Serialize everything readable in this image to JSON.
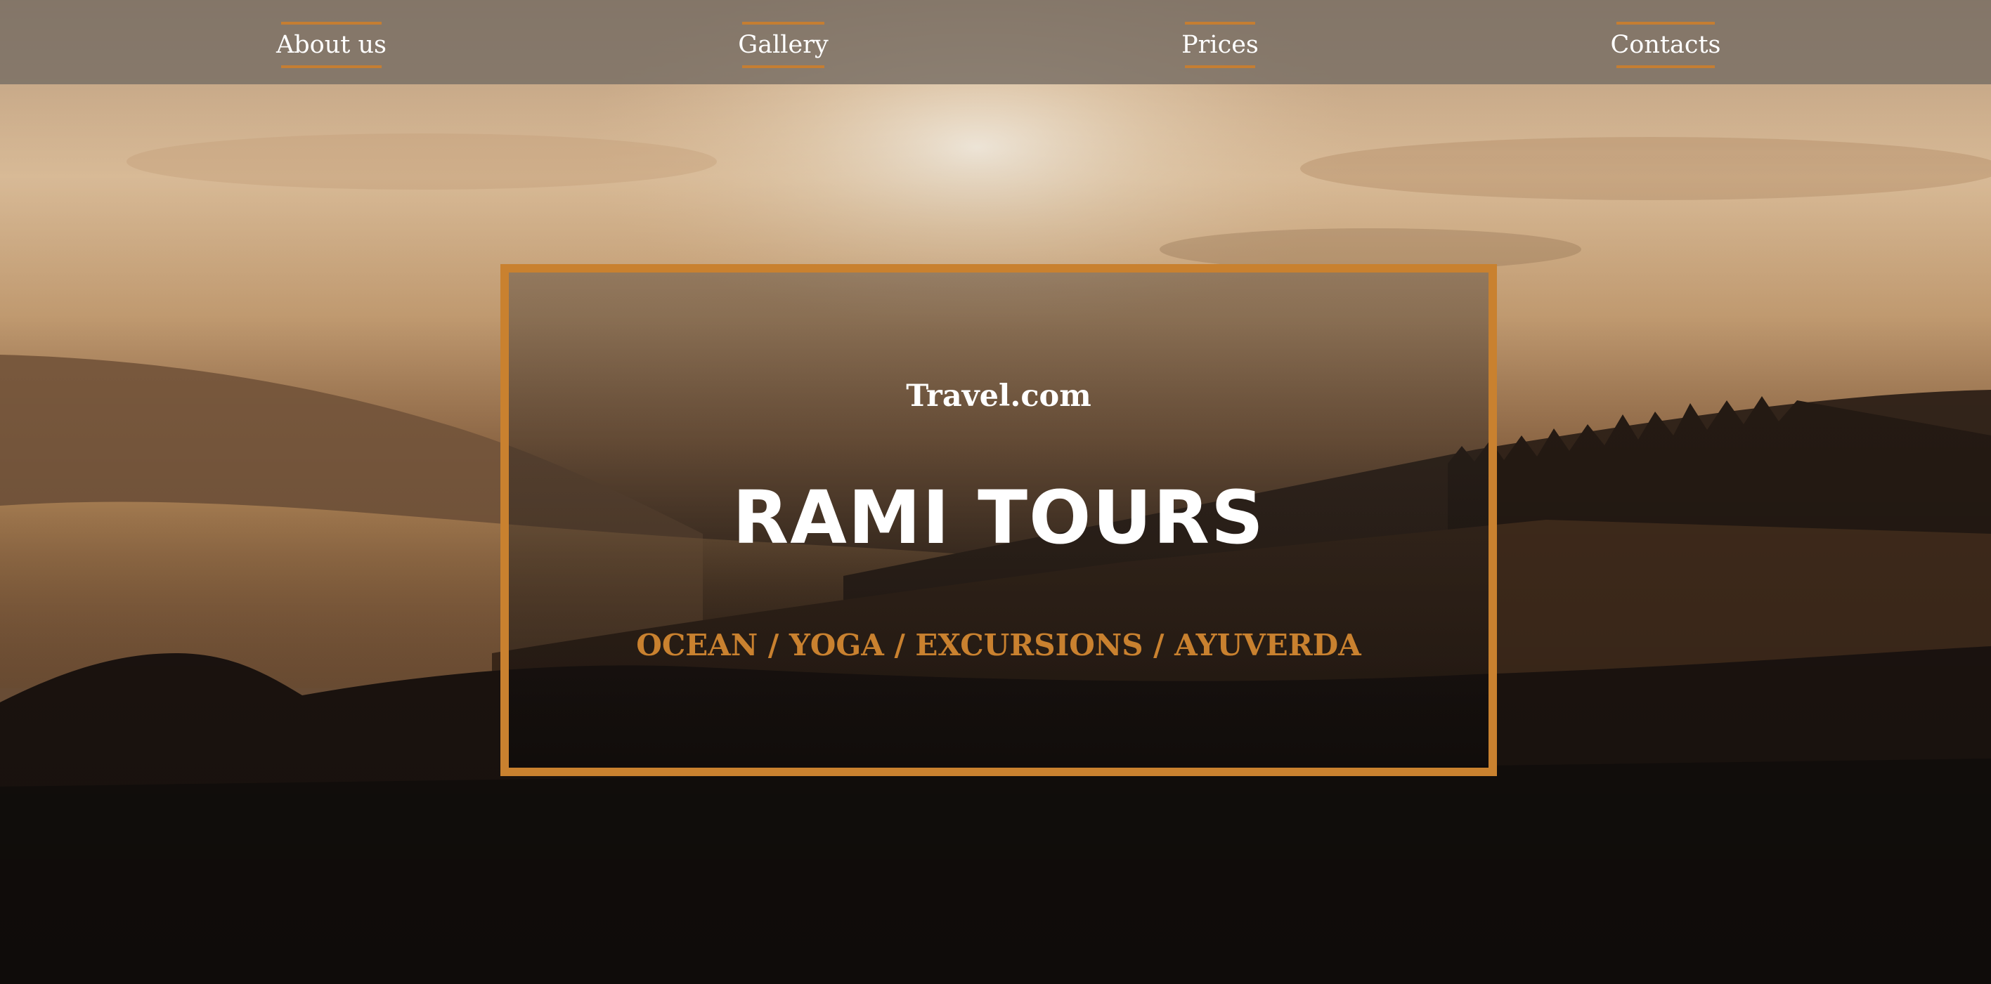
{
  "nav": {
    "items": [
      {
        "label": "About us"
      },
      {
        "label": "Gallery"
      },
      {
        "label": "Prices"
      },
      {
        "label": "Contacts"
      }
    ]
  },
  "hero": {
    "site_name": "Travel.com",
    "title": "RAMI TOURS",
    "tagline": "OCEAN / YOGA / EXCURSIONS / AYUVERDA"
  },
  "colors": {
    "accent": "#c9812f",
    "nav_bg": "#786e64",
    "text": "#ffffff"
  }
}
